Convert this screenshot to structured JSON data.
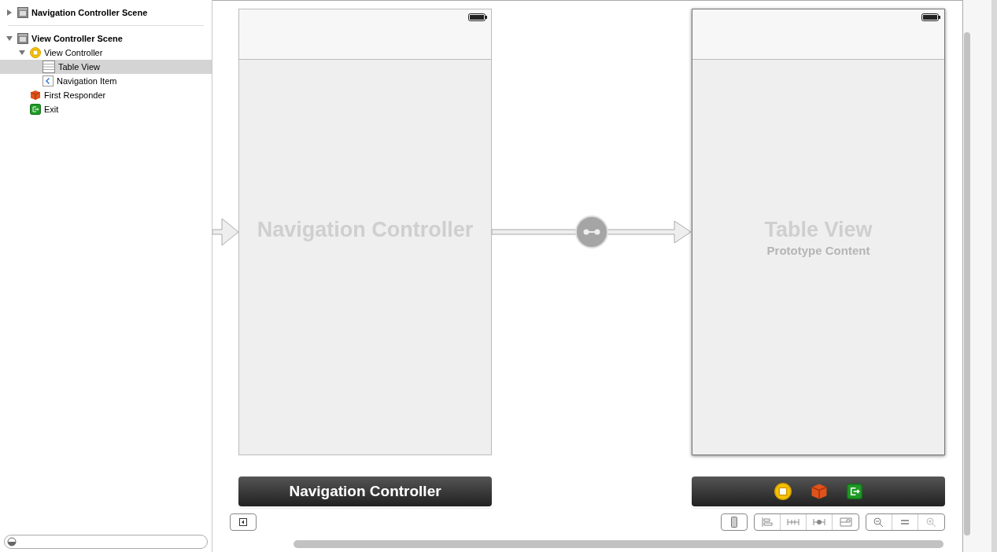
{
  "outline": [
    {
      "label": "Navigation Controller Scene",
      "kind": "scene",
      "expanded": false,
      "selected": false
    },
    {
      "label": "View Controller Scene",
      "kind": "scene",
      "expanded": true,
      "selected": false,
      "children": [
        {
          "label": "View Controller",
          "kind": "view-controller",
          "expanded": true,
          "selected": false,
          "children": [
            {
              "label": "Table View",
              "kind": "table-view",
              "selected": true
            },
            {
              "label": "Navigation Item",
              "kind": "navigation-item",
              "selected": false
            }
          ]
        },
        {
          "label": "First Responder",
          "kind": "first-responder",
          "selected": false
        },
        {
          "label": "Exit",
          "kind": "exit",
          "selected": false
        }
      ]
    }
  ],
  "scenes": [
    {
      "title": "Navigation Controller",
      "dock": {
        "kind": "label",
        "label": "Navigation Controller"
      },
      "selected": false
    },
    {
      "title": "Table View",
      "subtitle": "Prototype Content",
      "dock": {
        "kind": "icons"
      },
      "selected": true
    }
  ]
}
